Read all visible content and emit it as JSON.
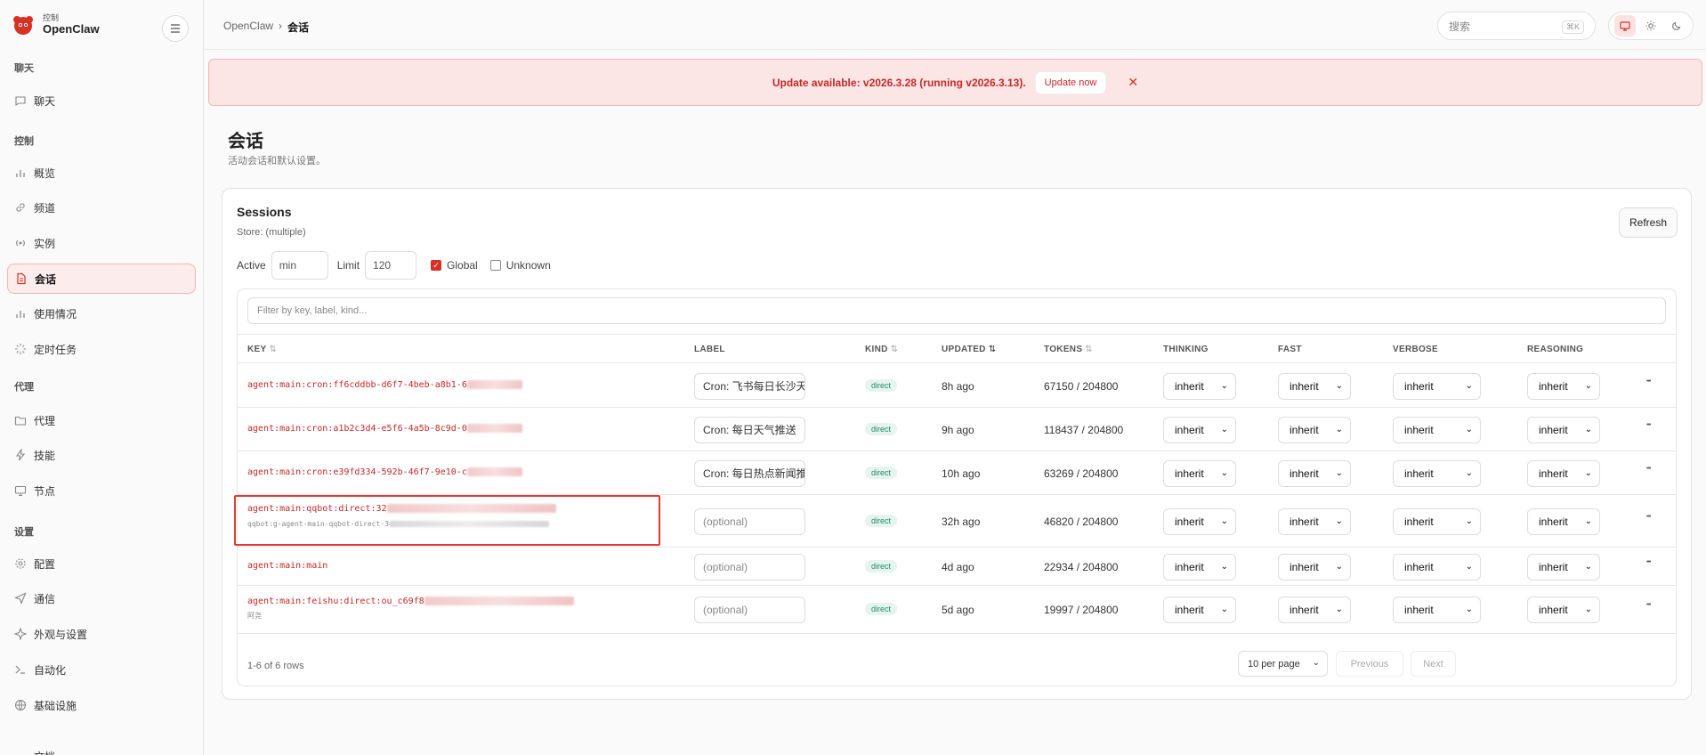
{
  "brand": {
    "sub": "控制",
    "name": "OpenClaw"
  },
  "sidebar": {
    "sections": [
      {
        "label": "聊天",
        "items": [
          {
            "label": "聊天",
            "icon": "chat-icon"
          }
        ]
      },
      {
        "label": "控制",
        "items": [
          {
            "label": "概览",
            "icon": "bar-chart-icon"
          },
          {
            "label": "频道",
            "icon": "link-icon"
          },
          {
            "label": "实例",
            "icon": "radio-icon"
          },
          {
            "label": "会话",
            "icon": "document-icon",
            "active": true
          },
          {
            "label": "使用情况",
            "icon": "bar-chart-icon"
          },
          {
            "label": "定时任务",
            "icon": "loader-icon"
          }
        ]
      },
      {
        "label": "代理",
        "items": [
          {
            "label": "代理",
            "icon": "folder-icon"
          },
          {
            "label": "技能",
            "icon": "bolt-icon"
          },
          {
            "label": "节点",
            "icon": "monitor-icon"
          }
        ]
      },
      {
        "label": "设置",
        "items": [
          {
            "label": "配置",
            "icon": "gear-icon"
          },
          {
            "label": "通信",
            "icon": "send-icon"
          },
          {
            "label": "外观与设置",
            "icon": "sparkle-icon"
          },
          {
            "label": "自动化",
            "icon": "terminal-icon"
          },
          {
            "label": "基础设施",
            "icon": "globe-icon"
          }
        ]
      }
    ],
    "partial_item": "文档"
  },
  "breadcrumb": {
    "root": "OpenClaw",
    "sep": "›",
    "current": "会话"
  },
  "search": {
    "placeholder": "搜索",
    "shortcut": "⌘K"
  },
  "banner": {
    "text": "Update available: v2026.3.28 (running v2026.3.13).",
    "button": "Update now",
    "close": "✕"
  },
  "page": {
    "title": "会话",
    "subtitle": "活动会话和默认设置。"
  },
  "card": {
    "title": "Sessions",
    "store": "Store: (multiple)",
    "refresh": "Refresh",
    "filters": {
      "active_label": "Active",
      "active_value": "min",
      "limit_label": "Limit",
      "limit_value": "120",
      "global_label": "Global",
      "global_checked": true,
      "unknown_label": "Unknown",
      "unknown_checked": false
    },
    "filter_placeholder": "Filter by key, label, kind..."
  },
  "table": {
    "headers": [
      "KEY",
      "LABEL",
      "KIND",
      "UPDATED",
      "TOKENS",
      "THINKING",
      "FAST",
      "VERBOSE",
      "REASONING"
    ],
    "rows": [
      {
        "key": "agent:main:cron:ff6cddbb-d6f7-4beb-a8b1-6",
        "sub": "",
        "label": "Cron: 飞书每日长沙天",
        "label_placeholder": false,
        "kind": "direct",
        "updated": "8h ago",
        "tokens": "67150 / 204800",
        "thinking": "inherit",
        "fast": "inherit",
        "verbose": "inherit",
        "reasoning": "inherit"
      },
      {
        "key": "agent:main:cron:a1b2c3d4-e5f6-4a5b-8c9d-0",
        "sub": "",
        "label": "Cron: 每日天气推送",
        "label_placeholder": false,
        "kind": "direct",
        "updated": "9h ago",
        "tokens": "118437 / 204800",
        "thinking": "inherit",
        "fast": "inherit",
        "verbose": "inherit",
        "reasoning": "inherit"
      },
      {
        "key": "agent:main:cron:e39fd334-592b-46f7-9e10-c",
        "sub": "",
        "label": "Cron: 每日热点新闻推",
        "label_placeholder": false,
        "kind": "direct",
        "updated": "10h ago",
        "tokens": "63269 / 204800",
        "thinking": "inherit",
        "fast": "inherit",
        "verbose": "inherit",
        "reasoning": "inherit"
      },
      {
        "key": "agent:main:qqbot:direct:32",
        "sub": "qqbot:g-agent-main-qqbot-direct-3",
        "label": "(optional)",
        "label_placeholder": true,
        "kind": "direct",
        "updated": "32h ago",
        "tokens": "46820 / 204800",
        "thinking": "inherit",
        "fast": "inherit",
        "verbose": "inherit",
        "reasoning": "inherit"
      },
      {
        "key": "agent:main:main",
        "sub": "",
        "label": "(optional)",
        "label_placeholder": true,
        "kind": "direct",
        "updated": "4d ago",
        "tokens": "22934 / 204800",
        "thinking": "inherit",
        "fast": "inherit",
        "verbose": "inherit",
        "reasoning": "inherit"
      },
      {
        "key": "agent:main:feishu:direct:ou_c69f8",
        "sub": "阿尧",
        "label": "(optional)",
        "label_placeholder": true,
        "kind": "direct",
        "updated": "5d ago",
        "tokens": "19997 / 204800",
        "thinking": "inherit",
        "fast": "inherit",
        "verbose": "inherit",
        "reasoning": "inherit"
      }
    ],
    "footer": "1-6 of 6 rows",
    "per_page": "10 per page",
    "prev": "Previous",
    "next": "Next"
  },
  "colors": {
    "accent": "#d93025",
    "banner_bg": "#fbe5e5",
    "badge_bg": "#e6f4ef",
    "badge_fg": "#1f8a6a"
  }
}
